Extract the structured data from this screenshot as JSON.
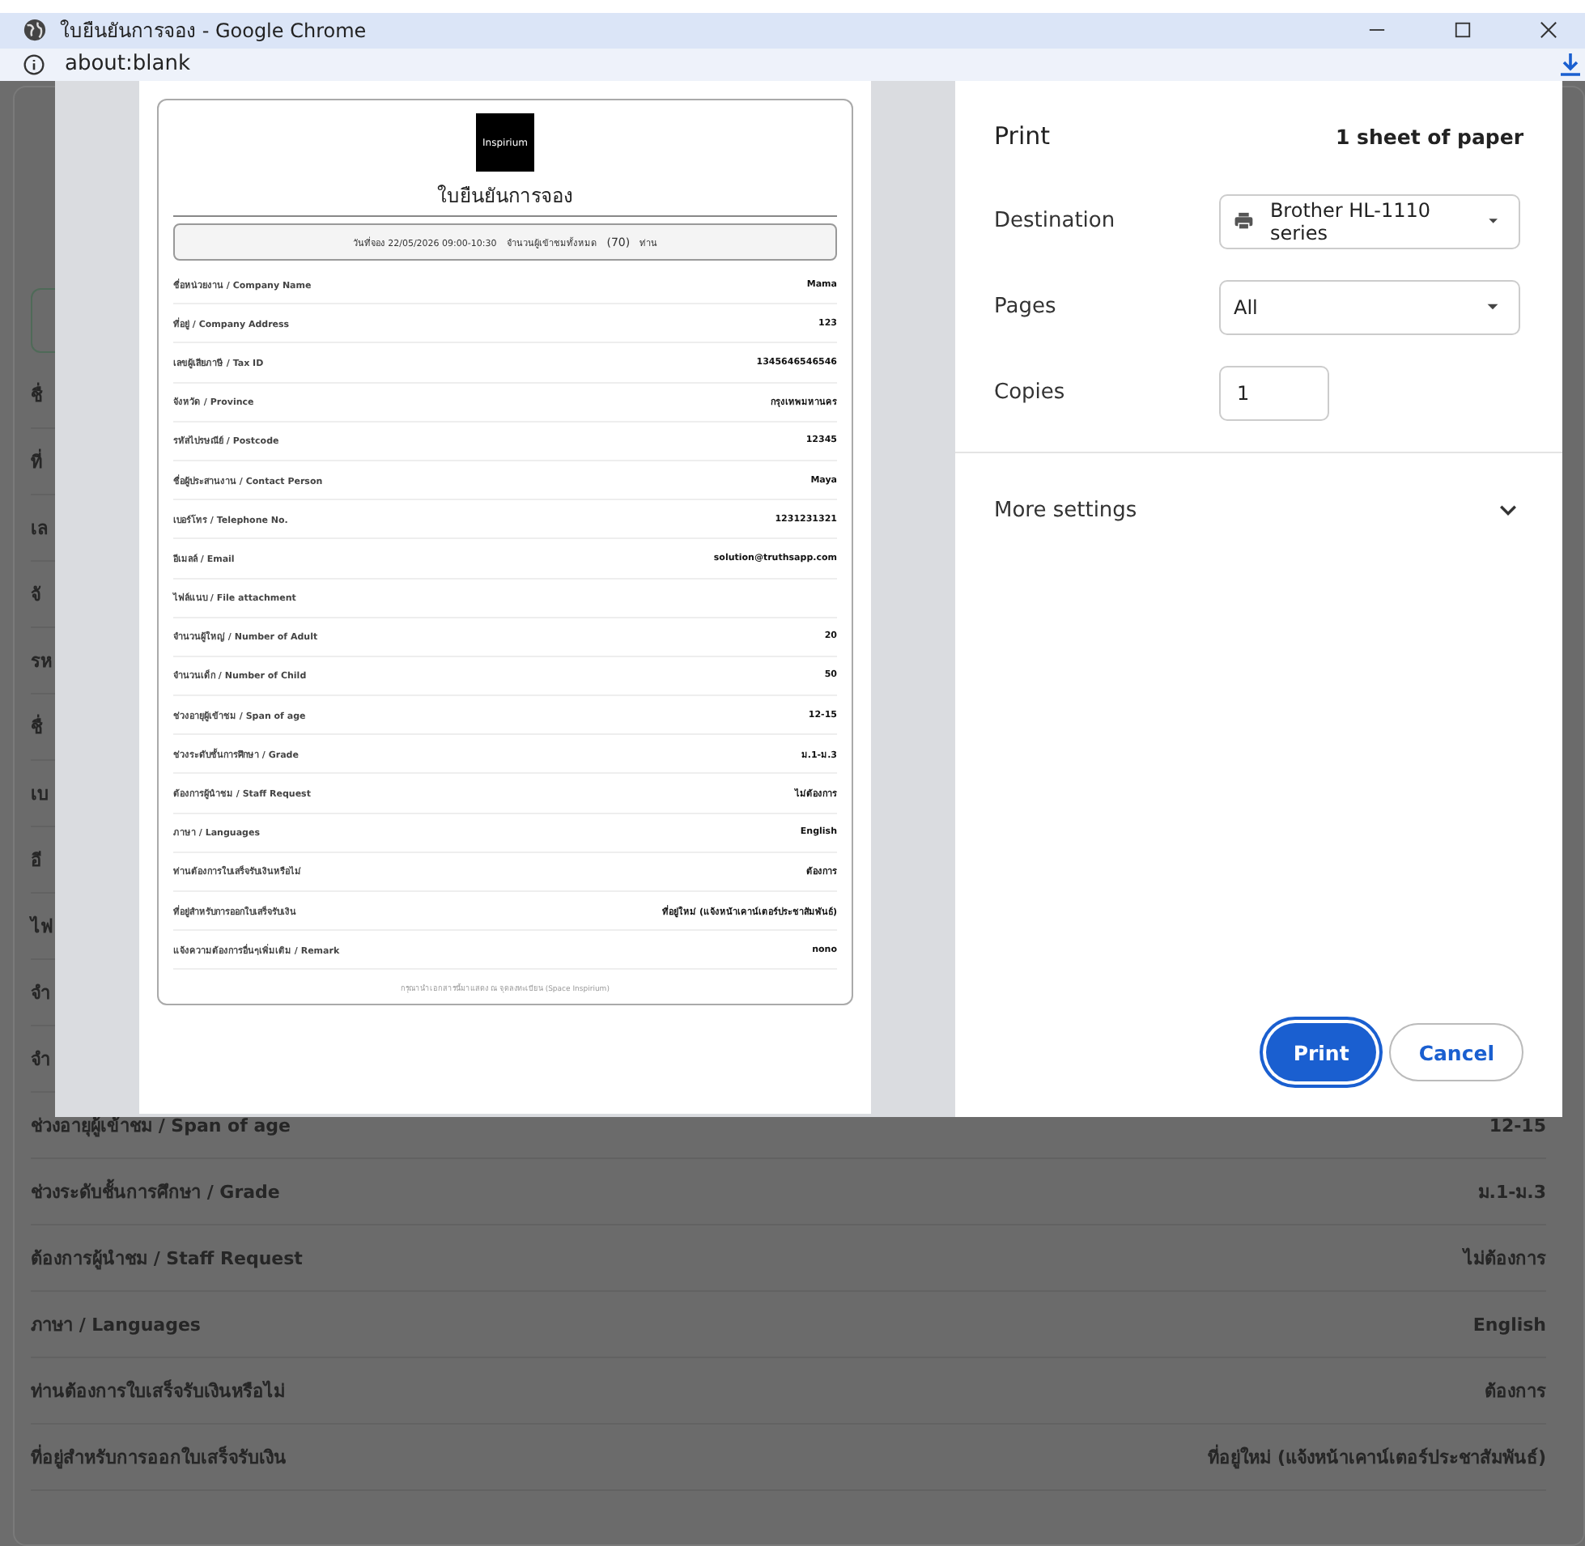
{
  "browser": {
    "title": "ใบยืนยันการจอง - Google Chrome",
    "address": "about:blank"
  },
  "page": {
    "rows": [
      {
        "label": "ชื่"
      },
      {
        "label": "ที่"
      },
      {
        "label": "เล"
      },
      {
        "label": "จั"
      },
      {
        "label": "รห"
      },
      {
        "label": "ชื่"
      },
      {
        "label": "เบ"
      },
      {
        "label": "อี"
      },
      {
        "label": "ไฟ"
      },
      {
        "label": "จำ"
      },
      {
        "label": "จำ"
      },
      {
        "label": "ช่วงอายุผู้เข้าชม / Span of age",
        "value": "12-15"
      },
      {
        "label": "ช่วงระดับชั้นการศึกษา / Grade",
        "value": "ม.1-ม.3"
      },
      {
        "label": "ต้องการผู้นำชม / Staff Request",
        "value": "ไม่ต้องการ"
      },
      {
        "label": "ภาษา / Languages",
        "value": "English"
      },
      {
        "label": "ท่านต้องการใบเสร็จรับเงินหรือไม่",
        "value": "ต้องการ"
      },
      {
        "label": "ที่อยู่สำหรับการออกใบเสร็จรับเงิน",
        "value": "ที่อยู่ใหม่ (แจ้งหน้าเคาน์เตอร์ประชาสัมพันธ์)"
      }
    ]
  },
  "print_dialog": {
    "title": "Print",
    "sheets": "1 sheet of paper",
    "settings": [
      {
        "kind": "printer-select",
        "label": "Destination",
        "value": "Brother HL-1110 series"
      },
      {
        "kind": "select",
        "label": "Pages",
        "value": "All"
      },
      {
        "kind": "number",
        "label": "Copies",
        "value": "1"
      }
    ],
    "more_settings": {
      "label": "More settings",
      "expanded": false
    },
    "buttons": [
      {
        "label": "Print",
        "primary": true
      },
      {
        "label": "Cancel",
        "primary": false
      }
    ],
    "preview": {
      "logo": "Inspirium",
      "title": "ใบยืนยันการจอง",
      "summary": [
        "วันที่จอง 22/05/2026 09:00-10:30",
        "จำนวนผู้เข้าชมทั้งหมด",
        "(70)",
        "ท่าน"
      ],
      "rows": [
        {
          "label": "ชื่อหน่วยงาน / Company Name",
          "value": "Mama"
        },
        {
          "label": "ที่อยู่ / Company Address",
          "value": "123"
        },
        {
          "label": "เลขผู้เสียภาษี / Tax ID",
          "value": "1345646546546"
        },
        {
          "label": "จังหวัด / Province",
          "value": "กรุงเทพมหานคร"
        },
        {
          "label": "รหัสไปรษณีย์ / Postcode",
          "value": "12345"
        },
        {
          "label": "ชื่อผู้ประสานงาน / Contact Person",
          "value": "Maya"
        },
        {
          "label": "เบอร์โทร / Telephone No.",
          "value": "1231231321"
        },
        {
          "label": "อีเมลล์ / Email",
          "value": "solution@truthsapp.com"
        },
        {
          "label": "ไฟล์แนบ / File attachment"
        },
        {
          "label": "จำนวนผู้ใหญ่ / Number of Adult",
          "value": "20"
        },
        {
          "label": "จำนวนเด็ก / Number of Child",
          "value": "50"
        },
        {
          "label": "ช่วงอายุผู้เข้าชม / Span of age",
          "value": "12-15"
        },
        {
          "label": "ช่วงระดับชั้นการศึกษา / Grade",
          "value": "ม.1-ม.3"
        },
        {
          "label": "ต้องการผู้นำชม / Staff Request",
          "value": "ไม่ต้องการ"
        },
        {
          "label": "ภาษา / Languages",
          "value": "English"
        },
        {
          "label": "ท่านต้องการใบเสร็จรับเงินหรือไม่",
          "value": "ต้องการ"
        },
        {
          "label": "ที่อยู่สำหรับการออกใบเสร็จรับเงิน",
          "value": "ที่อยู่ใหม่ (แจ้งหน้าเคาน์เตอร์ประชาสัมพันธ์)"
        },
        {
          "label": "แจ้งความต้องการอื่นๆเพิ่มเติม / Remark",
          "value": "nono"
        }
      ],
      "footer": "กรุณานำเอกสารนี้มาแสดง ณ จุดลงทะเบียน (Space Inspirium)"
    }
  }
}
